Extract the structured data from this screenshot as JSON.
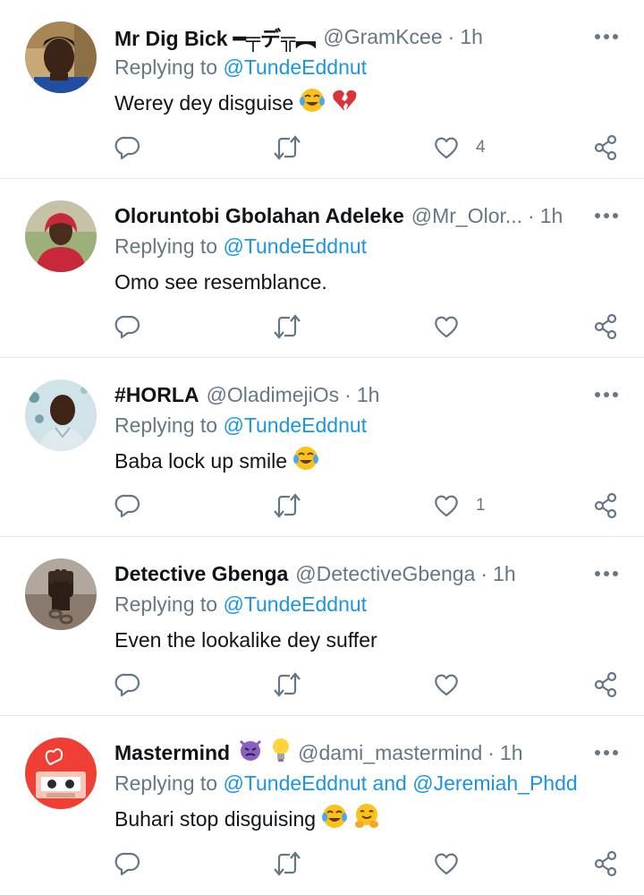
{
  "colors": {
    "link": "#1b95e0",
    "muted": "#657786",
    "text": "#0f1419",
    "divider": "#e1e8ed"
  },
  "tweets": [
    {
      "name": "Mr Dig Bick ━╤デ╦︻",
      "handle": "@GramKcee",
      "time": "1h",
      "reply_prefix": "Replying to",
      "reply_to": "@TundeEddnut",
      "text": "Werey dey disguise",
      "emojis": [
        "tears-of-joy",
        "broken-heart"
      ],
      "like_count": "4",
      "avatar": "young-man-portrait"
    },
    {
      "name": "Oloruntobi Gbolahan Adeleke",
      "handle": "@Mr_Olor...",
      "time": "1h",
      "reply_prefix": "Replying to",
      "reply_to": "@TundeEddnut",
      "text": "Omo see resemblance.",
      "emojis": [],
      "like_count": "",
      "avatar": "man-red-hoodie"
    },
    {
      "name": "#HORLA",
      "handle": "@OladimejiOs",
      "time": "1h",
      "reply_prefix": "Replying to",
      "reply_to": "@TundeEddnut",
      "text": "Baba lock up smile",
      "emojis": [
        "tears-of-joy"
      ],
      "like_count": "1",
      "avatar": "man-bokeh"
    },
    {
      "name": "Detective Gbenga",
      "handle": "@DetectiveGbenga",
      "time": "1h",
      "reply_prefix": "Replying to",
      "reply_to": "@TundeEddnut",
      "text": "Even the lookalike dey suffer",
      "emojis": [],
      "like_count": "",
      "avatar": "raised-fist-chain"
    },
    {
      "name": "Mastermind",
      "handle": "@dami_mastermind",
      "time": "1h",
      "reply_prefix": "Replying to",
      "reply_to": "@TundeEddnut and @Jeremiah_Phdd",
      "text": "Buhari stop disguising",
      "emojis": [
        "tears-of-joy",
        "hugging-face"
      ],
      "name_emojis": [
        "angry-devil",
        "light-bulb"
      ],
      "like_count": "",
      "avatar": "cassette-heart"
    }
  ]
}
